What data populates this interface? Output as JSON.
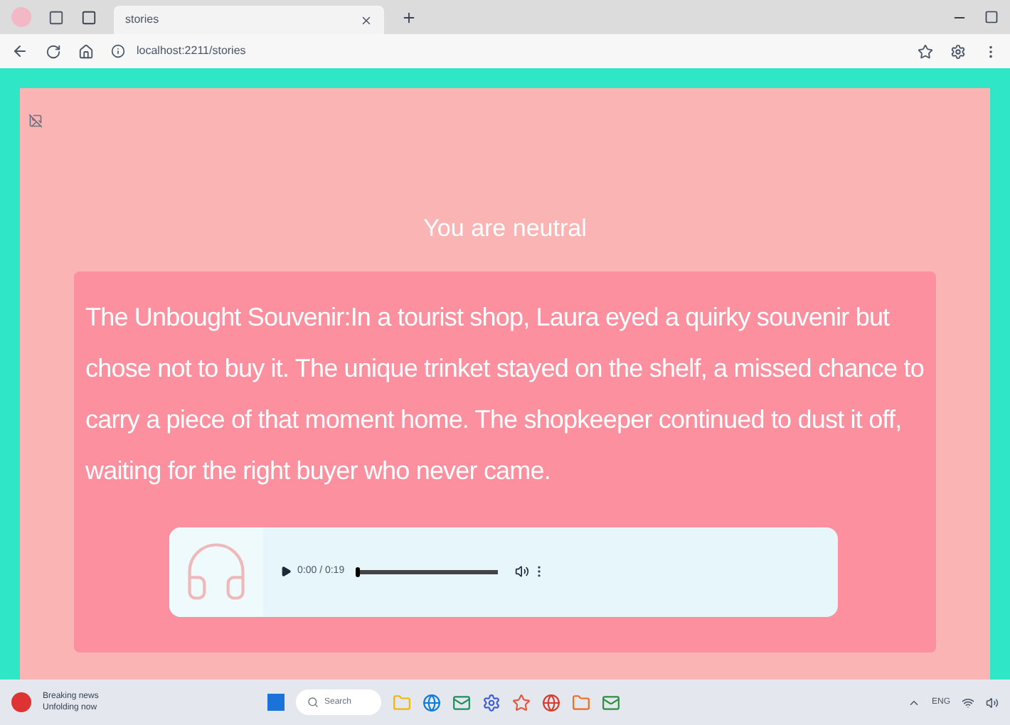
{
  "browser": {
    "tab": {
      "title": "stories"
    },
    "address": "localhost:2211/stories"
  },
  "page": {
    "title": "You are neutral",
    "story": "The Unbought Souvenir:In a tourist shop, Laura eyed a quirky souvenir but chose not to buy it. The unique trinket stayed on the shelf, a missed chance to carry a piece of that moment home. The shopkeeper continued to dust it off, waiting for the right buyer who never came.",
    "audio": {
      "time": "0:00 / 0:19",
      "level": 0
    }
  },
  "taskbar": {
    "news": {
      "title": "Breaking news",
      "subtitle": "Unfolding now"
    },
    "search": {
      "placeholder": "Search"
    },
    "language": "ENG"
  }
}
